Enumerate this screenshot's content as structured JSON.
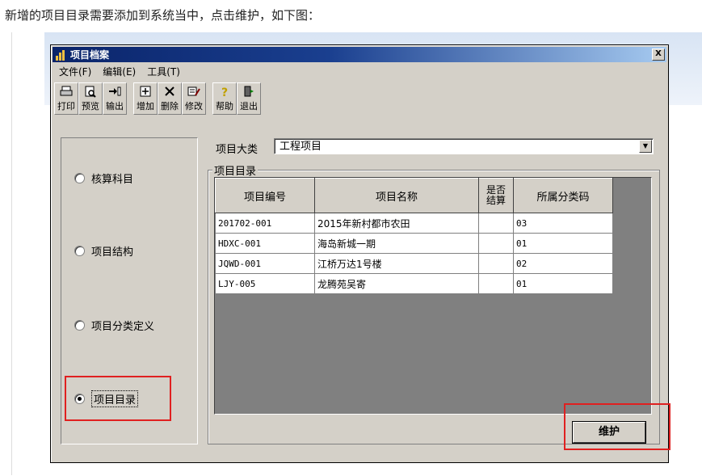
{
  "caption": "新增的项目目录需要添加到系统当中，点击维护，如下图：",
  "window": {
    "title": "项目档案",
    "close": "X"
  },
  "menu": [
    "文件(F)",
    "编辑(E)",
    "工具(T)"
  ],
  "toolbar": [
    {
      "label": "打印",
      "icon": "printer-icon"
    },
    {
      "label": "预览",
      "icon": "preview-icon"
    },
    {
      "label": "输出",
      "icon": "export-icon"
    },
    {
      "label": "增加",
      "icon": "add-icon"
    },
    {
      "label": "删除",
      "icon": "delete-icon"
    },
    {
      "label": "修改",
      "icon": "edit-icon"
    },
    {
      "label": "帮助",
      "icon": "help-icon"
    },
    {
      "label": "退出",
      "icon": "exit-icon"
    }
  ],
  "left_options": [
    {
      "label": "核算科目",
      "selected": false
    },
    {
      "label": "项目结构",
      "selected": false
    },
    {
      "label": "项目分类定义",
      "selected": false
    },
    {
      "label": "项目目录",
      "selected": true
    }
  ],
  "category": {
    "label": "项目大类",
    "value": "工程项目"
  },
  "group_title": "项目目录",
  "table": {
    "headers": [
      "项目编号",
      "项目名称",
      "是否结算",
      "所属分类码"
    ],
    "rows": [
      [
        "201702-001",
        "2015年新村都市农田",
        "",
        "03"
      ],
      [
        "HDXC-001",
        "海岛新城一期",
        "",
        "01"
      ],
      [
        "JQWD-001",
        "江桥万达1号楼",
        "",
        "02"
      ],
      [
        "LJY-005",
        "龙腾苑吴寄",
        "",
        "01"
      ]
    ]
  },
  "maintain_button": "维护",
  "colors": {
    "highlight": "#e02020",
    "titlebar": "#0a246a",
    "face": "#d4d0c8"
  }
}
